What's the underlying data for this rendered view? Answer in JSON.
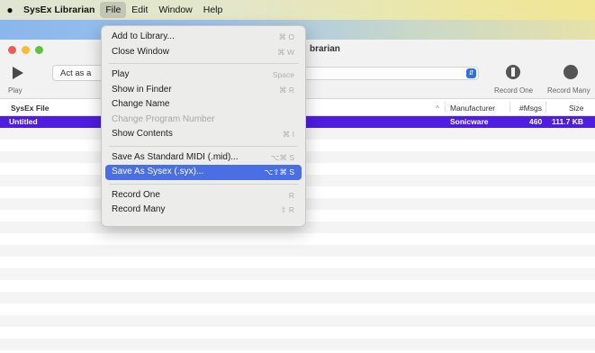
{
  "menubar": {
    "apple": "",
    "app_name": "SysEx Librarian",
    "menus": [
      "File",
      "Edit",
      "Window",
      "Help"
    ]
  },
  "window": {
    "title": "SysEx Librarian",
    "title_visible_fragment": "brarian",
    "toolbar": {
      "play_label": "Play",
      "act_as": "Act as a",
      "record_one_label": "Record One",
      "record_many_label": "Record Many"
    }
  },
  "table": {
    "columns": {
      "name": "SysEx File",
      "manufacturer": "Manufacturer",
      "messages": "#Msgs",
      "size": "Size"
    },
    "sort_indicator": "^",
    "rows": [
      {
        "name": "Untitled",
        "manufacturer": "Sonicware",
        "messages": "460",
        "size": "111.7 KB"
      }
    ]
  },
  "file_menu": {
    "items": [
      {
        "label": "Add to Library...",
        "shortcut": "⌘ O",
        "disabled": false
      },
      {
        "label": "Close Window",
        "shortcut": "⌘ W",
        "disabled": false
      },
      {
        "sep": true
      },
      {
        "label": "Play",
        "shortcut": "Space",
        "disabled": false
      },
      {
        "label": "Show in Finder",
        "shortcut": "⌘ R",
        "disabled": false
      },
      {
        "label": "Change Name",
        "shortcut": "",
        "disabled": false
      },
      {
        "label": "Change Program Number",
        "shortcut": "",
        "disabled": true
      },
      {
        "label": "Show Contents",
        "shortcut": "⌘ I",
        "disabled": false
      },
      {
        "sep": true
      },
      {
        "label": "Save As Standard MIDI (.mid)...",
        "shortcut": "⌥⌘ S",
        "disabled": false
      },
      {
        "label": "Save As Sysex (.syx)...",
        "shortcut": "⌥⇧⌘ S",
        "disabled": false,
        "highlighted": true
      },
      {
        "sep": true
      },
      {
        "label": "Record One",
        "shortcut": "R",
        "disabled": false
      },
      {
        "label": "Record Many",
        "shortcut": "⇧ R",
        "disabled": false
      }
    ]
  },
  "colors": {
    "selection": "#4e1ddf",
    "menu_highlight": "#4a6fe4"
  }
}
